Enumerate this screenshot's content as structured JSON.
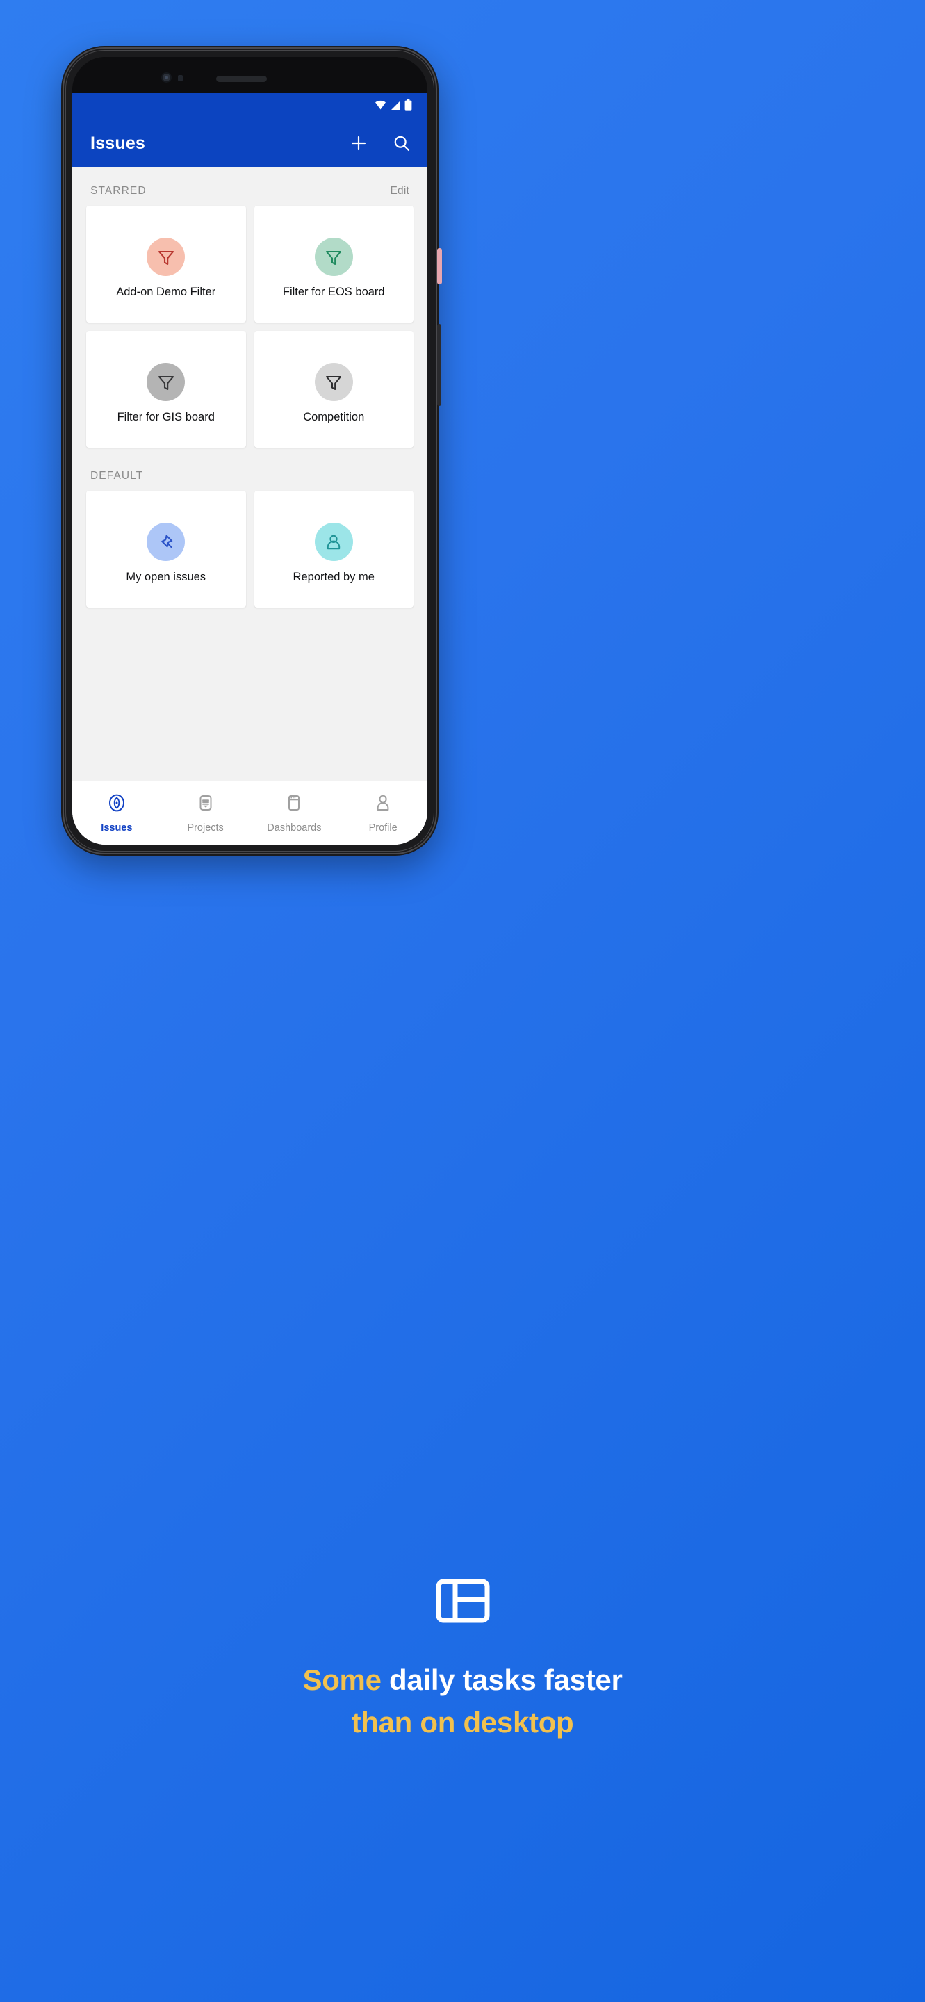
{
  "statusbar": {
    "icons": [
      "wifi-icon",
      "cellular-signal-icon",
      "battery-icon"
    ]
  },
  "appbar": {
    "title": "Issues",
    "add_icon": "plus-icon",
    "search_icon": "search-icon",
    "background": "#0c44c0"
  },
  "sections": [
    {
      "key": "starred",
      "title": "STARRED",
      "action_label": "Edit",
      "cards": [
        {
          "label": "Add-on Demo Filter",
          "icon": "funnel-icon",
          "circle_color": "#f7bfae",
          "icon_color": "#b8372f"
        },
        {
          "label": "Filter for EOS board",
          "icon": "funnel-icon",
          "circle_color": "#b2dbc8",
          "icon_color": "#1f8a5f"
        },
        {
          "label": "Filter for GIS board",
          "icon": "funnel-icon",
          "circle_color": "#b4b4b4",
          "icon_color": "#38383a"
        },
        {
          "label": "Competition",
          "icon": "funnel-icon",
          "circle_color": "#d6d6d6",
          "icon_color": "#2e2e30"
        }
      ]
    },
    {
      "key": "default",
      "title": "DEFAULT",
      "action_label": "",
      "cards": [
        {
          "label": "My open issues",
          "icon": "pin-icon",
          "circle_color": "#adc6f7",
          "icon_color": "#2b53c8"
        },
        {
          "label": "Reported by me",
          "icon": "person-icon",
          "circle_color": "#9ce5e8",
          "icon_color": "#1f9396"
        }
      ]
    }
  ],
  "bottomnav": {
    "items": [
      {
        "label": "Issues",
        "icon": "issues-compass-icon",
        "active": true
      },
      {
        "label": "Projects",
        "icon": "projects-icon",
        "active": false
      },
      {
        "label": "Dashboards",
        "icon": "dashboards-icon",
        "active": false
      },
      {
        "label": "Profile",
        "icon": "profile-person-icon",
        "active": false
      }
    ],
    "active_color": "#1141c4",
    "inactive_color": "#8d8d8d"
  },
  "tagline": {
    "icon": "layout-dashboard-icon",
    "line1_gold": "Some",
    "line1_white": "daily tasks faster",
    "line2_gold": "than on desktop",
    "gold_color": "#f2c14e",
    "white_color": "#ffffff"
  }
}
